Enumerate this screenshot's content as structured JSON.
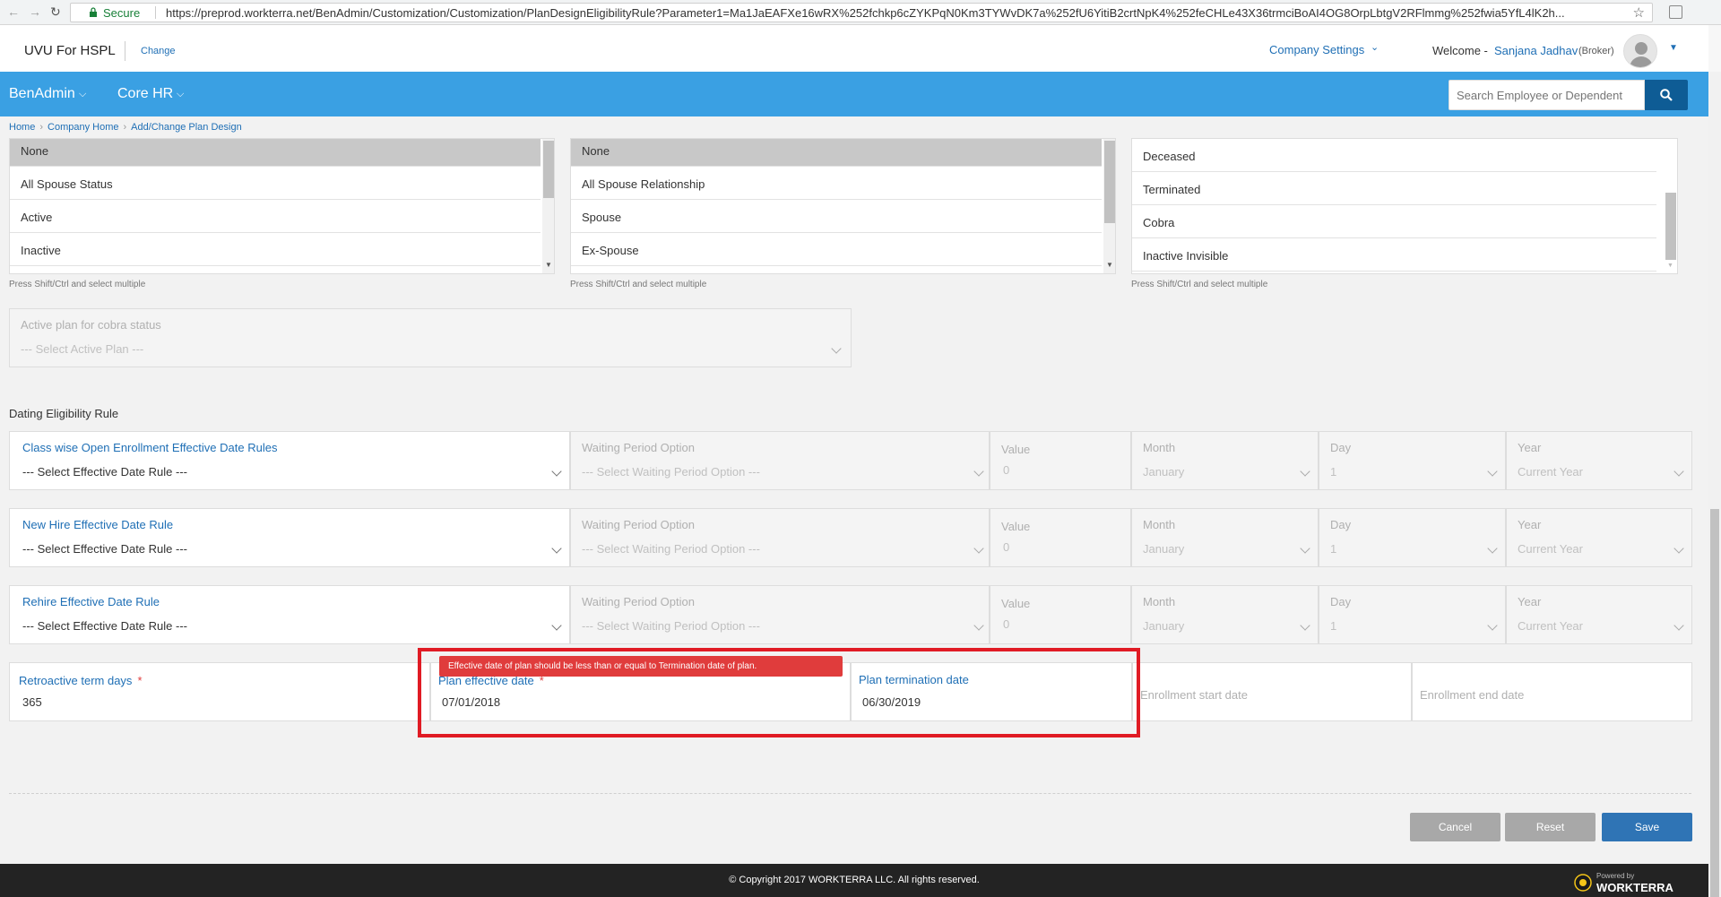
{
  "browser": {
    "secure_label": "Secure",
    "url": "https://preprod.workterra.net/BenAdmin/Customization/Customization/PlanDesignEligibilityRule?Parameter1=Ma1JaEAFXe16wRX%252fchkp6cZYKPqN0Km3TYWvDK7a%252fU6YitiB2crtNpK4%252feCHLe43X36trmciBoAI4OG8OrpLbtgV2RFlmmg%252fwia5YfL4lK2h..."
  },
  "header": {
    "company_name": "UVU For HSPL",
    "change_label": "Change",
    "company_settings": "Company Settings",
    "welcome": "Welcome -",
    "user_name": "Sanjana Jadhav",
    "user_role": "(Broker)"
  },
  "nav": {
    "items": [
      "BenAdmin",
      "Core HR"
    ],
    "search_placeholder": "Search Employee or Dependent"
  },
  "breadcrumb": [
    "Home",
    "Company Home",
    "Add/Change Plan Design"
  ],
  "listboxes": [
    {
      "items": [
        "None",
        "All Spouse Status",
        "Active",
        "Inactive"
      ],
      "selected": "None",
      "hint": "Press Shift/Ctrl and select multiple"
    },
    {
      "items": [
        "None",
        "All Spouse Relationship",
        "Spouse",
        "Ex-Spouse"
      ],
      "selected": "None",
      "hint": "Press Shift/Ctrl and select multiple"
    },
    {
      "items": [
        "Deceased",
        "Terminated",
        "Cobra",
        "Inactive Invisible"
      ],
      "hint": "Press Shift/Ctrl and select multiple"
    }
  ],
  "cobra_plan": {
    "label": "Active plan for cobra status",
    "placeholder": "--- Select Active Plan ---"
  },
  "section_title": "Dating Eligibility Rule",
  "date_rules": [
    {
      "label": "Class wise Open Enrollment Effective Date Rules",
      "value": "--- Select Effective Date Rule ---"
    },
    {
      "label": "New Hire Effective Date Rule",
      "value": "--- Select Effective Date Rule ---"
    },
    {
      "label": "Rehire Effective Date Rule",
      "value": "--- Select Effective Date Rule ---"
    }
  ],
  "waiting": {
    "label": "Waiting Period Option",
    "placeholder": "--- Select Waiting Period Option ---",
    "value_label": "Value",
    "value": "0",
    "month_label": "Month",
    "month": "January",
    "day_label": "Day",
    "day": "1",
    "year_label": "Year",
    "year": "Current Year"
  },
  "term": {
    "retro_label": "Retroactive term days",
    "retro_value": "365",
    "effective_label": "Plan effective date",
    "effective_value": "07/01/2018",
    "termination_label": "Plan termination date",
    "termination_value": "06/30/2019",
    "enroll_start_label": "Enrollment start date",
    "enroll_end_label": "Enrollment end date",
    "required_mark": "*"
  },
  "error_message": "Effective date of plan should be less than or equal to Termination date of plan.",
  "buttons": {
    "cancel": "Cancel",
    "reset": "Reset",
    "save": "Save"
  },
  "footer": {
    "copyright": "© Copyright 2017 WORKTERRA LLC. All rights reserved.",
    "powered_by": "Powered by",
    "brand": "WORKTERRA"
  },
  "colors": {
    "nav_blue": "#3aa0e3",
    "link_blue": "#1f6fb5",
    "error_red": "#e03c3c",
    "save_blue": "#2f74b5",
    "gray_button": "#a8a8a8"
  }
}
